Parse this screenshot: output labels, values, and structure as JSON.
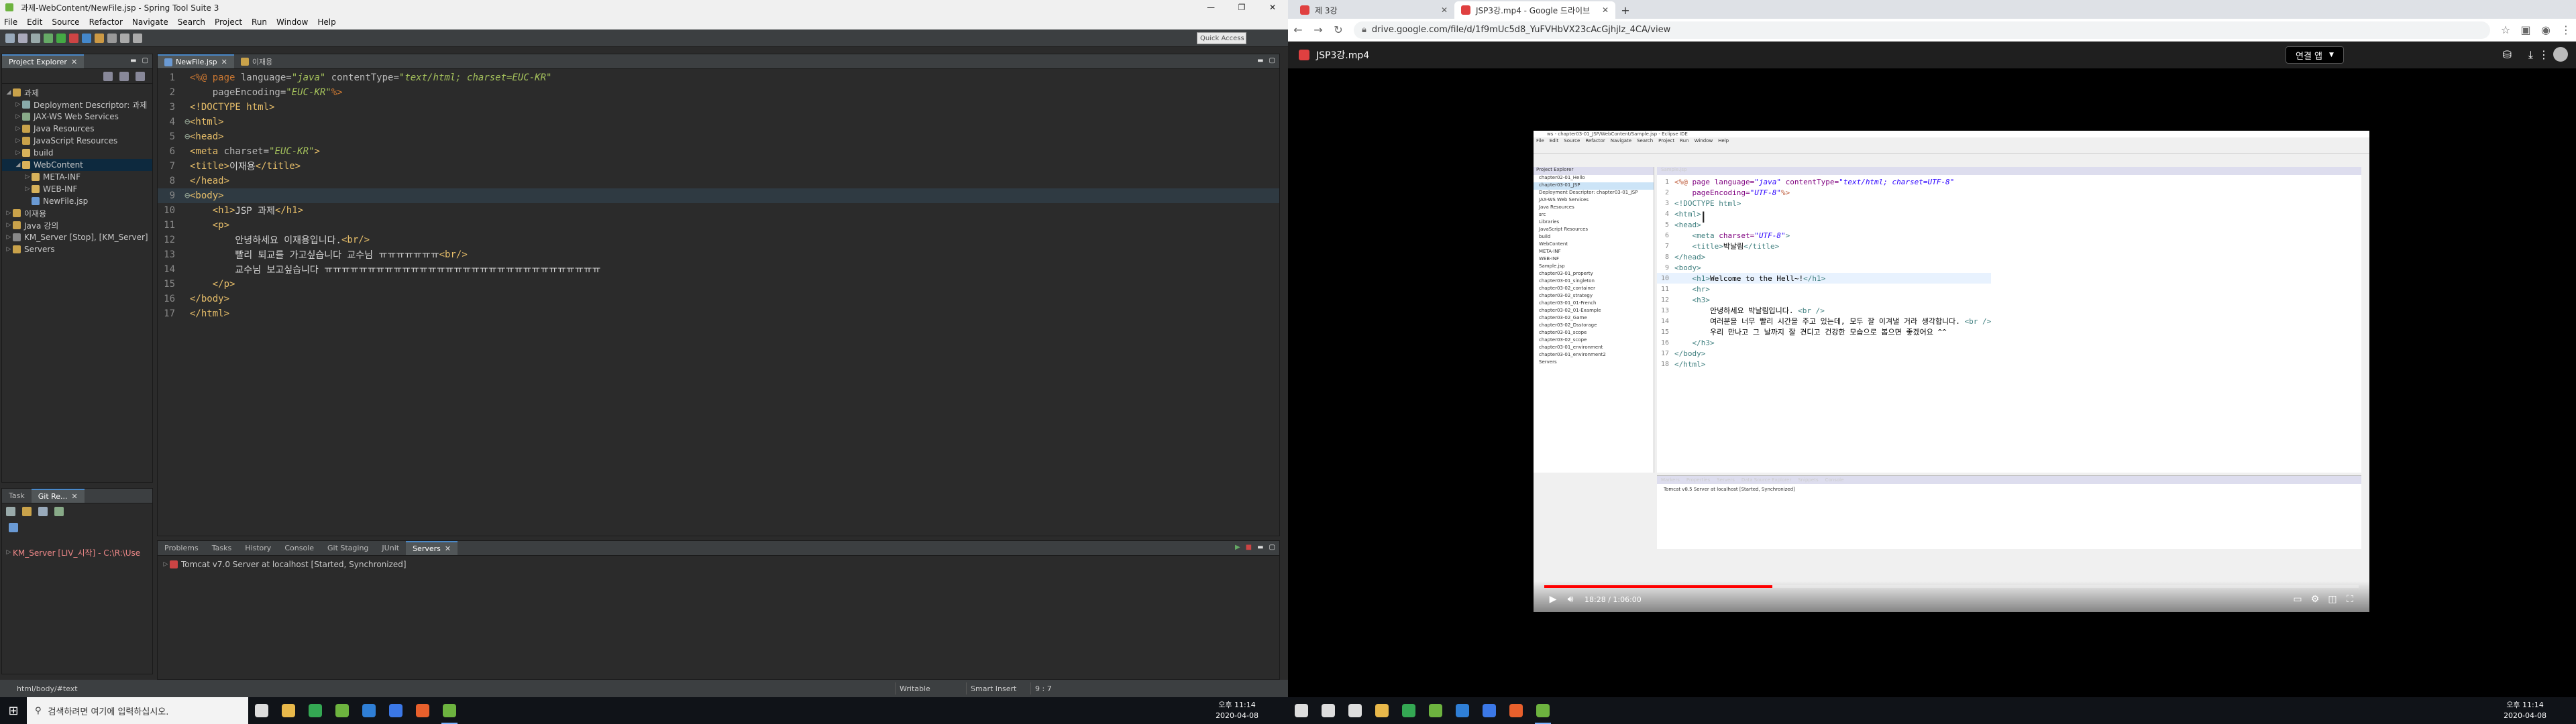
{
  "sts": {
    "title": "과제-WebContent/NewFile.jsp - Spring Tool Suite 3",
    "window_controls": [
      "—",
      "❐",
      "✕"
    ],
    "menu": [
      "File",
      "Edit",
      "Source",
      "Refactor",
      "Navigate",
      "Search",
      "Project",
      "Run",
      "Window",
      "Help"
    ],
    "quick_access": "Quick Access",
    "project_explorer_tab": "Project Explorer",
    "tree": [
      {
        "label": "과제",
        "depth": 0,
        "arrow": "◢",
        "icon": "#c9a24a"
      },
      {
        "label": "Deployment Descriptor: 과제",
        "depth": 1,
        "arrow": "▷",
        "icon": "#8aa"
      },
      {
        "label": "JAX-WS Web Services",
        "depth": 1,
        "arrow": "▷",
        "icon": "#8a8"
      },
      {
        "label": "Java Resources",
        "depth": 1,
        "arrow": "▷",
        "icon": "#c9a24a"
      },
      {
        "label": "JavaScript Resources",
        "depth": 1,
        "arrow": "▷",
        "icon": "#c9a24a"
      },
      {
        "label": "build",
        "depth": 1,
        "arrow": "▷",
        "icon": "#d8b25a"
      },
      {
        "label": "WebContent",
        "depth": 1,
        "arrow": "◢",
        "icon": "#d8b25a",
        "selected": true
      },
      {
        "label": "META-INF",
        "depth": 2,
        "arrow": "▷",
        "icon": "#d8b25a"
      },
      {
        "label": "WEB-INF",
        "depth": 2,
        "arrow": "▷",
        "icon": "#d8b25a"
      },
      {
        "label": "NewFile.jsp",
        "depth": 2,
        "arrow": "",
        "icon": "#6a9ad4"
      },
      {
        "label": "이재용",
        "depth": 0,
        "arrow": "▷",
        "icon": "#c9a24a"
      },
      {
        "label": "Java 강의",
        "depth": 0,
        "arrow": "▷",
        "icon": "#c9a24a"
      },
      {
        "label": "KM_Server [Stop], [KM_Server]",
        "depth": 0,
        "arrow": "▷",
        "icon": "#888"
      },
      {
        "label": "Servers",
        "depth": 0,
        "arrow": "▷",
        "icon": "#c9a24a"
      }
    ],
    "task_tabs": [
      "Task",
      "Git Re..."
    ],
    "task_item": "KM_Server [LIV_시작] - C:\\R:\\Use",
    "editor_tabs": [
      "NewFile.jsp",
      "이재용"
    ],
    "code_lines": [
      [
        [
          "c-jsp",
          "<%@ "
        ],
        [
          "c-kw",
          "page "
        ],
        [
          "c-attr",
          "language="
        ],
        [
          "c-str",
          "\"java\""
        ],
        [
          "c-attr",
          " contentType="
        ],
        [
          "c-str",
          "\"text/html; charset=EUC-KR\""
        ]
      ],
      [
        [
          "c-attr",
          "    pageEncoding="
        ],
        [
          "c-str",
          "\"EUC-KR\""
        ],
        [
          "c-jsp",
          "%>"
        ]
      ],
      [
        [
          "c-tag",
          "<!DOCTYPE html>"
        ]
      ],
      [
        [
          "c-tag",
          "<html>"
        ]
      ],
      [
        [
          "c-tag",
          "<head>"
        ]
      ],
      [
        [
          "c-tag",
          "<meta "
        ],
        [
          "c-attr",
          "charset="
        ],
        [
          "c-str",
          "\"EUC-KR\""
        ],
        [
          "c-tag",
          ">"
        ]
      ],
      [
        [
          "c-tag",
          "<title>"
        ],
        [
          "c-txt",
          "이재용"
        ],
        [
          "c-tag",
          "</title>"
        ]
      ],
      [
        [
          "c-tag",
          "</head>"
        ]
      ],
      [
        [
          "c-tag",
          "<body>"
        ]
      ],
      [
        [
          "c-txt",
          "    "
        ],
        [
          "c-tag",
          "<h1>"
        ],
        [
          "c-txt",
          "JSP 과제"
        ],
        [
          "c-tag",
          "</h1>"
        ]
      ],
      [
        [
          "c-txt",
          "    "
        ],
        [
          "c-tag",
          "<p>"
        ]
      ],
      [
        [
          "c-txt",
          "        안녕하세요 이재용입니다."
        ],
        [
          "c-tag",
          "<br/>"
        ]
      ],
      [
        [
          "c-txt",
          "        빨리 퇴교를 가고싶습니다 교수님 ㅠㅠㅠㅠㅠㅠㅠ"
        ],
        [
          "c-tag",
          "<br/>"
        ]
      ],
      [
        [
          "c-txt",
          "        교수님 보고싶습니다 ㅠㅠㅠㅠㅠㅠㅠㅠㅠㅠㅠㅠㅠㅠㅠㅠㅠㅠㅠㅠㅠㅠㅠㅠㅠㅠㅠㅠㅠㅠㅠㅠ"
        ]
      ],
      [
        [
          "c-txt",
          "    "
        ],
        [
          "c-tag",
          "</p>"
        ]
      ],
      [
        [
          "c-tag",
          "</body>"
        ]
      ],
      [
        [
          "c-tag",
          "</html>"
        ]
      ]
    ],
    "bottom_tabs": [
      "Problems",
      "Tasks",
      "History",
      "Console",
      "Git Staging",
      "JUnit",
      "Servers"
    ],
    "server_row": "Tomcat v7.0 Server at localhost  [Started, Synchronized]",
    "status_path": "html/body/#text",
    "status_writable": "Writable",
    "status_insert": "Smart Insert",
    "status_pos": "9 : 7"
  },
  "taskbar_left": {
    "search_placeholder": "검색하려면 여기에 입력하십시오.",
    "icons": [
      {
        "name": "task-view-icon",
        "color": "#ddd"
      },
      {
        "name": "file-explorer-icon",
        "color": "#e8b84a"
      },
      {
        "name": "chrome-icon",
        "color": "#34a853"
      },
      {
        "name": "sts-icon",
        "color": "#6db33f"
      },
      {
        "name": "vscode-icon",
        "color": "#2f7fd6"
      },
      {
        "name": "shield-icon",
        "color": "#3b78e7"
      },
      {
        "name": "orange-app-icon",
        "color": "#e8602c"
      },
      {
        "name": "sts-active-icon",
        "color": "#6db33f"
      }
    ],
    "time": "오후 11:14",
    "date": "2020-04-08"
  },
  "chrome": {
    "tabs": [
      {
        "label": "제 3강",
        "favicon": "#e04040"
      },
      {
        "label": "JSP3강.mp4 - Google 드라이브",
        "favicon": "#e04040"
      }
    ],
    "new_tab": "+",
    "url": "drive.google.com/file/d/1f9mUc5d8_YuFVHbVX23cAcGjhjlz_4CA/view",
    "file_title": "JSP3강.mp4",
    "open_with": "연결 앱",
    "video": {
      "title": "ws - chapter03-01_JSP/WebContent/Sample.jsp - Eclipse IDE",
      "menu": [
        "File",
        "Edit",
        "Source",
        "Refactor",
        "Navigate",
        "Search",
        "Project",
        "Run",
        "Window",
        "Help"
      ],
      "explorer_title": "Project Explorer",
      "tree": [
        "chapter02-01_Hello",
        "chapter03-01_JSP",
        "Deployment Descriptor: chapter03-01_JSP",
        "JAX-WS Web Services",
        "Java Resources",
        "src",
        "Libraries",
        "JavaScript Resources",
        "build",
        "WebContent",
        "META-INF",
        "WEB-INF",
        "Sample.jsp",
        "chapter03-01_property",
        "chapter03-01_singleton",
        "chapter03-02_container",
        "chapter03-02_strategy",
        "chapter03-01_01-French",
        "chapter03-02_01-Example",
        "chapter03-02_Game",
        "chapter03-02_Dsstorage",
        "chapter03-01_scope",
        "chapter03-02_scope",
        "chapter03-01_environment",
        "chapter03-01_environment2",
        "Servers"
      ],
      "editor_tab": "Sample.jsp",
      "code_lines": [
        [
          [
            "vt-jsp",
            "<%@ "
          ],
          [
            "vt-attr",
            "page "
          ],
          [
            "vt-attr",
            "language="
          ],
          [
            "vt-str",
            "\"java\""
          ],
          [
            "vt-attr",
            " contentType="
          ],
          [
            "vt-str",
            "\"text/html; charset=UTF-8\""
          ]
        ],
        [
          [
            "vt-attr",
            "    pageEncoding="
          ],
          [
            "vt-str",
            "\"UTF-8\""
          ],
          [
            "vt-jsp",
            "%>"
          ]
        ],
        [
          [
            "vt-tag",
            "<!DOCTYPE html>"
          ]
        ],
        [
          [
            "vt-tag",
            "<html>"
          ]
        ],
        [
          [
            "vt-tag",
            "<head>"
          ]
        ],
        [
          [
            "vt-txt",
            "    "
          ],
          [
            "vt-tag",
            "<meta "
          ],
          [
            "vt-attr",
            "charset="
          ],
          [
            "vt-str",
            "\"UTF-8\""
          ],
          [
            "vt-tag",
            ">"
          ]
        ],
        [
          [
            "vt-txt",
            "    "
          ],
          [
            "vt-tag",
            "<title>"
          ],
          [
            "vt-txt",
            "박날림"
          ],
          [
            "vt-tag",
            "</title>"
          ]
        ],
        [
          [
            "vt-tag",
            "</head>"
          ]
        ],
        [
          [
            "vt-tag",
            "<body>"
          ]
        ],
        [
          [
            "vt-txt",
            "    "
          ],
          [
            "vt-tag",
            "<h1>"
          ],
          [
            "vt-txt",
            "Welcome to the Hell~!"
          ],
          [
            "vt-tag",
            "</h1>"
          ]
        ],
        [
          [
            "vt-txt",
            "    "
          ],
          [
            "vt-tag",
            "<hr>"
          ]
        ],
        [
          [
            "vt-txt",
            "    "
          ],
          [
            "vt-tag",
            "<h3>"
          ]
        ],
        [
          [
            "vt-txt",
            "        안녕하세요 박날림입니다. "
          ],
          [
            "vt-tag",
            "<br />"
          ]
        ],
        [
          [
            "vt-txt",
            "        여러분을 너무 빨리 시간을 주고 있는데, 모두 잘 이겨낼 거라 생각합니다. "
          ],
          [
            "vt-tag",
            "<br />"
          ]
        ],
        [
          [
            "vt-txt",
            "        우리 만나고 그 날까지 잘 견디고 건강한 모습으로 봅으면 좋겠어요 ^^"
          ]
        ],
        [
          [
            "vt-txt",
            "    "
          ],
          [
            "vt-tag",
            "</h3>"
          ]
        ],
        [
          [
            "vt-tag",
            "</body>"
          ]
        ],
        [
          [
            "vt-tag",
            "</html>"
          ]
        ]
      ],
      "bottom_tabs": [
        "Markers",
        "Properties",
        "Servers",
        "Data Source Explorer",
        "Snippets",
        "Console"
      ],
      "server_row": "Tomcat v8.5 Server at localhost  [Started, Synchronized]",
      "time": "18:28 / 1:06:00",
      "progress": 0.28
    }
  },
  "taskbar_right": {
    "icons": [
      {
        "name": "start-icon",
        "color": "#ddd"
      },
      {
        "name": "search-icon",
        "color": "#ddd"
      },
      {
        "name": "task-view-icon",
        "color": "#ddd"
      },
      {
        "name": "file-explorer-icon",
        "color": "#e8b84a"
      },
      {
        "name": "chrome-icon",
        "color": "#34a853"
      },
      {
        "name": "sts-icon",
        "color": "#6db33f"
      },
      {
        "name": "vscode-icon",
        "color": "#2f7fd6"
      },
      {
        "name": "shield-icon",
        "color": "#3b78e7"
      },
      {
        "name": "orange-app-icon",
        "color": "#e8602c"
      },
      {
        "name": "sts-active-icon",
        "color": "#6db33f"
      }
    ],
    "time": "오후 11:14",
    "date": "2020-04-08"
  }
}
